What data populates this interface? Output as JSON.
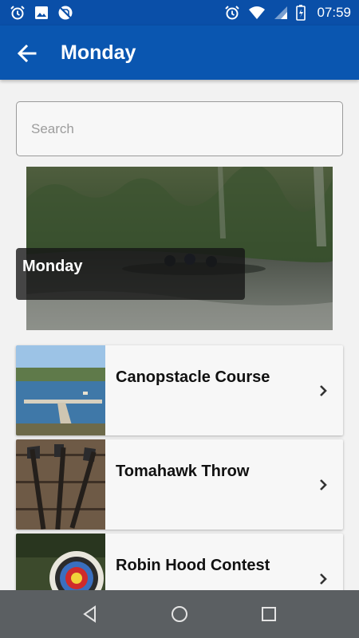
{
  "status_bar": {
    "time": "07:59",
    "left_icons": [
      "alarm-icon",
      "image-icon",
      "no-sim-icon"
    ],
    "right_icons": [
      "alarm-icon",
      "wifi-icon",
      "signal-icon",
      "battery-icon"
    ]
  },
  "app_bar": {
    "title": "Monday",
    "back_icon": "arrow-left-icon"
  },
  "search": {
    "placeholder": "Search",
    "value": ""
  },
  "hero": {
    "caption": "Monday",
    "image": "river-with-canoes"
  },
  "activities": [
    {
      "title": "Canopstacle Course",
      "thumb": "lake-dock"
    },
    {
      "title": "Tomahawk Throw",
      "thumb": "tomahawks-on-bench"
    },
    {
      "title": "Robin Hood Contest",
      "thumb": "archery-target"
    }
  ],
  "nav_bar": {
    "buttons": [
      "back-triangle-icon",
      "home-circle-icon",
      "recents-square-icon"
    ]
  },
  "colors": {
    "status_bar": "#0a4fa8",
    "app_bar": "#0a56b0",
    "background": "#f2f2f2",
    "card": "#f7f7f7",
    "nav_bar": "#5b5f62"
  }
}
